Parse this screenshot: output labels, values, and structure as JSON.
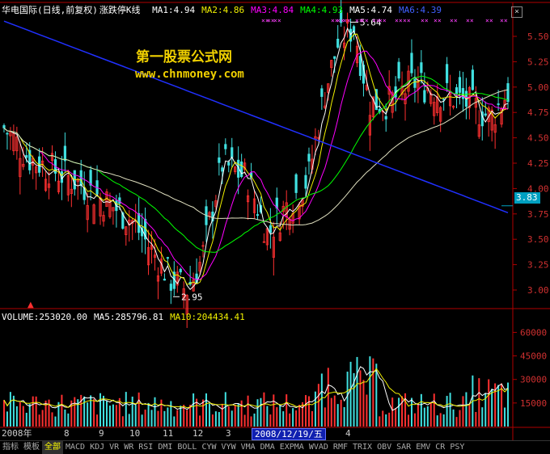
{
  "header": {
    "stock_title": "华电国际(日线,前复权)",
    "indicator_name": "涨跌停K线",
    "ma_readouts": [
      {
        "label": "MA1:4.94",
        "color": "#ffffff"
      },
      {
        "label": "MA2:4.86",
        "color": "#f0f000"
      },
      {
        "label": "MA3:4.84",
        "color": "#ff00ff"
      },
      {
        "label": "MA4:4.93",
        "color": "#00ff00"
      },
      {
        "label": "MA5:4.74",
        "color": "#ffffff"
      },
      {
        "label": "MA6:4.39",
        "color": "#4060ff"
      }
    ]
  },
  "watermark": {
    "line1": "第一股票公式网",
    "line2": "www.chnmoney.com"
  },
  "annotations": {
    "high_label": "5.64",
    "low_label": "2.95",
    "current_price": "3.83"
  },
  "price_axis": [
    "5.50",
    "5.25",
    "5.00",
    "4.75",
    "4.50",
    "4.25",
    "4.00",
    "3.75",
    "3.50",
    "3.25",
    "3.00"
  ],
  "volume_legend": [
    {
      "label": "VOLUME:253020.00",
      "color": "#ffffff"
    },
    {
      "label": "MA5:285796.81",
      "color": "#ffffff"
    },
    {
      "label": "MA10:204434.41",
      "color": "#f0f000"
    }
  ],
  "volume_axis": [
    "60000",
    "45000",
    "30000",
    "15000"
  ],
  "x_axis": {
    "labels": [
      "2008年",
      "8",
      "9",
      "10",
      "11",
      "12",
      "3",
      "4"
    ],
    "cursor_date": "2008/12/19/五"
  },
  "bottom_tabs": [
    "指标",
    "模板",
    "全部",
    "MACD",
    "KDJ",
    "VR",
    "WR",
    "RSI",
    "DMI",
    "BOLL",
    "CYW",
    "VYW",
    "VMA",
    "DMA",
    "EXPMA",
    "WVAD",
    "RMF",
    "TRIX",
    "OBV",
    "SAR",
    "EMV",
    "CR",
    "PSY"
  ],
  "icons": {
    "close": "close-icon"
  },
  "chart_data": {
    "type": "candlestick",
    "title": "华电国际(日线,前复权) 涨跌停K线",
    "ylim": [
      2.85,
      5.65
    ],
    "annotated_high": 5.64,
    "annotated_low": 2.95,
    "current": 3.83,
    "volume_ylim": [
      0,
      70000
    ]
  }
}
